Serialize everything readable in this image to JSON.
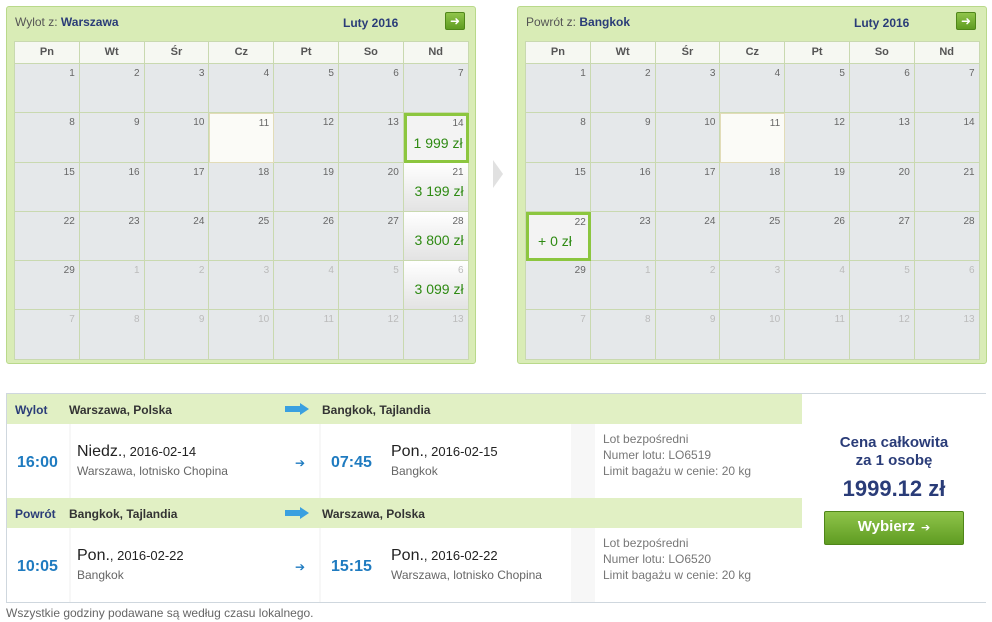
{
  "departure_calendar": {
    "label": "Wylot z:",
    "city": "Warszawa",
    "month": "Luty 2016",
    "next_icon": "arrow-right-icon",
    "weekdays": [
      "Pn",
      "Wt",
      "Śr",
      "Cz",
      "Pt",
      "So",
      "Nd"
    ],
    "days": [
      [
        "1",
        "2",
        "3",
        "4",
        "5",
        "6",
        "7"
      ],
      [
        "8",
        "9",
        "10",
        "11",
        "12",
        "13",
        "14"
      ],
      [
        "15",
        "16",
        "17",
        "18",
        "19",
        "20",
        "21"
      ],
      [
        "22",
        "23",
        "24",
        "25",
        "26",
        "27",
        "28"
      ],
      [
        "29",
        "1",
        "2",
        "3",
        "4",
        "5",
        "6"
      ],
      [
        "7",
        "8",
        "9",
        "10",
        "11",
        "12",
        "13"
      ]
    ],
    "prices": {
      "14": "1 999 zł",
      "21": "3 199 zł",
      "28": "3 800 zł",
      "6": "3 099 zł"
    }
  },
  "return_calendar": {
    "label": "Powrót z:",
    "city": "Bangkok",
    "month": "Luty 2016",
    "next_icon": "arrow-right-icon",
    "weekdays": [
      "Pn",
      "Wt",
      "Śr",
      "Cz",
      "Pt",
      "So",
      "Nd"
    ],
    "days": [
      [
        "1",
        "2",
        "3",
        "4",
        "5",
        "6",
        "7"
      ],
      [
        "8",
        "9",
        "10",
        "11",
        "12",
        "13",
        "14"
      ],
      [
        "15",
        "16",
        "17",
        "18",
        "19",
        "20",
        "21"
      ],
      [
        "22",
        "23",
        "24",
        "25",
        "26",
        "27",
        "28"
      ],
      [
        "29",
        "1",
        "2",
        "3",
        "4",
        "5",
        "6"
      ],
      [
        "7",
        "8",
        "9",
        "10",
        "11",
        "12",
        "13"
      ]
    ],
    "prices": {
      "22": "+ 0 zł"
    }
  },
  "outbound": {
    "type_label": "Wylot",
    "from": "Warszawa, Polska",
    "to": "Bangkok, Tajlandia",
    "dep_time": "16:00",
    "dep_day": "Niedz.",
    "dep_date": ", 2016-02-14",
    "dep_place": "Warszawa, lotnisko Chopina",
    "arr_time": "07:45",
    "arr_day": "Pon.",
    "arr_date": ", 2016-02-15",
    "arr_place": "Bangkok",
    "info1": "Lot bezpośredni",
    "info2": "Numer lotu: LO6519",
    "info3": "Limit bagażu w cenie: 20 kg"
  },
  "inbound": {
    "type_label": "Powrót",
    "from": "Bangkok, Tajlandia",
    "to": "Warszawa, Polska",
    "dep_time": "10:05",
    "dep_day": "Pon.",
    "dep_date": ", 2016-02-22",
    "dep_place": "Bangkok",
    "arr_time": "15:15",
    "arr_day": "Pon.",
    "arr_date": ", 2016-02-22",
    "arr_place": "Warszawa, lotnisko Chopina",
    "info1": "Lot bezpośredni",
    "info2": "Numer lotu: LO6520",
    "info3": "Limit bagażu w cenie: 20 kg"
  },
  "price": {
    "label_line1": "Cena całkowita",
    "label_line2": "za 1 osobę",
    "amount": "1999.12 zł",
    "button_label": "Wybierz",
    "button_icon": "arrow-right-icon"
  },
  "footnote": "Wszystkie godziny podawane są według czasu lokalnego.",
  "colors": {
    "accent_green": "#8cc63f",
    "price_green": "#2e8a12",
    "brand_navy": "#2a3c78",
    "time_blue": "#1f7bc0"
  }
}
